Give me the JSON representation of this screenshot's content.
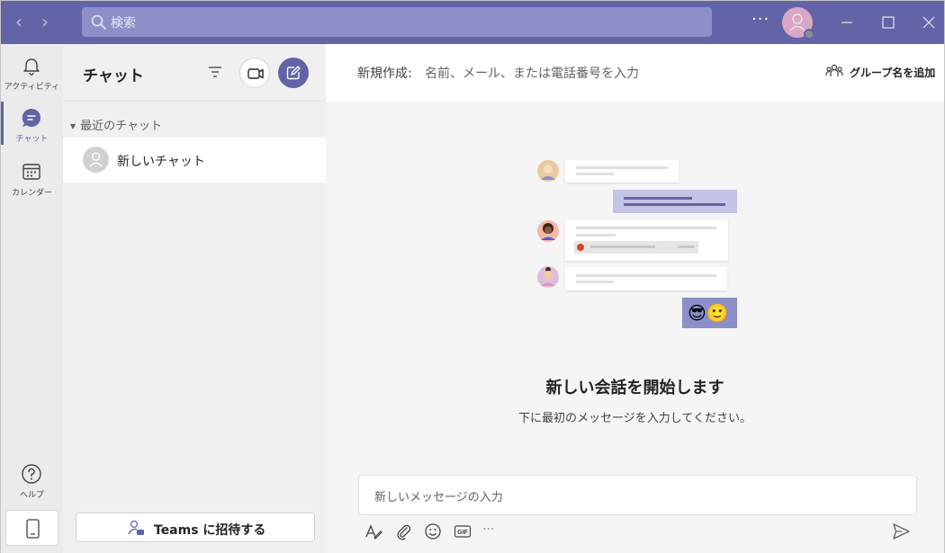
{
  "titlebar": {
    "search_placeholder": "検索",
    "more_label": "···",
    "accent": "#6264a7"
  },
  "rail": {
    "items": [
      {
        "label": "アクティビティ",
        "icon": "bell-icon"
      },
      {
        "label": "チャット",
        "icon": "chat-icon"
      },
      {
        "label": "カレンダー",
        "icon": "calendar-icon"
      },
      {
        "label": "ヘルプ",
        "icon": "help-icon"
      }
    ],
    "active": "チャット"
  },
  "chat_panel": {
    "title": "チャット",
    "section_title": "最近のチャット",
    "chats": [
      {
        "name": "新しいチャット"
      }
    ],
    "invite_label": "Teams に招待する"
  },
  "main": {
    "new_label": "新規作成:",
    "to_placeholder": "名前、メール、または電話番号を入力",
    "group_name_label": "グループ名を追加",
    "empty_title": "新しい会話を開始します",
    "empty_subtitle": "下に最初のメッセージを入力してください。",
    "compose_placeholder": "新しいメッセージの入力",
    "toolbar_icons": [
      "format-icon",
      "attach-icon",
      "emoji-icon",
      "gif-icon",
      "more-icon",
      "send-icon"
    ],
    "gif_label": "GIF",
    "emojis": "😎🙂"
  }
}
